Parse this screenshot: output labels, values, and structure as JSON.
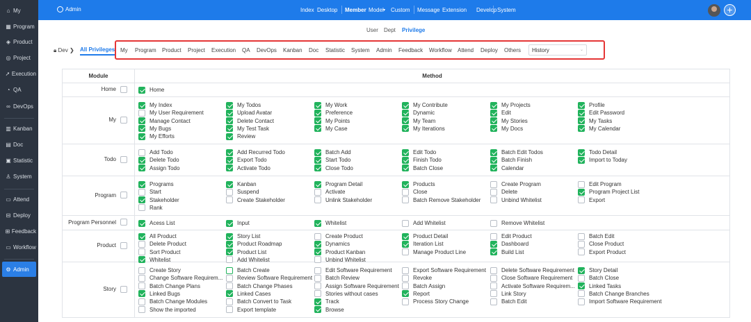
{
  "sidebar": {
    "items": [
      {
        "label": "My",
        "icon": "home-icon",
        "glyph": "⌂"
      },
      {
        "label": "Program",
        "icon": "grid-icon",
        "glyph": "▦"
      },
      {
        "label": "Product",
        "icon": "product-icon",
        "glyph": "◈"
      },
      {
        "label": "Project",
        "icon": "project-icon",
        "glyph": "◎"
      },
      {
        "label": "Execution",
        "icon": "execution-icon",
        "glyph": "➚"
      },
      {
        "label": "QA",
        "icon": "qa-icon",
        "glyph": "◔"
      },
      {
        "label": "DevOps",
        "icon": "devops-icon",
        "glyph": "∞"
      },
      {
        "label": "Kanban",
        "icon": "kanban-icon",
        "glyph": "▥"
      },
      {
        "label": "Doc",
        "icon": "doc-icon",
        "glyph": "▤"
      },
      {
        "label": "Statistic",
        "icon": "statistic-icon",
        "glyph": "▣"
      },
      {
        "label": "System",
        "icon": "system-icon",
        "glyph": "♙"
      },
      {
        "label": "Attend",
        "icon": "attend-icon",
        "glyph": "▭"
      },
      {
        "label": "Deploy",
        "icon": "deploy-icon",
        "glyph": "⊟"
      },
      {
        "label": "Feedback",
        "icon": "feedback-icon",
        "glyph": "⊞"
      },
      {
        "label": "Workflow",
        "icon": "workflow-icon",
        "glyph": "▭"
      },
      {
        "label": "Admin",
        "icon": "admin-icon",
        "glyph": "⚙"
      }
    ],
    "active": "Admin"
  },
  "topbar": {
    "brand": "Admin",
    "nav": [
      "Index",
      "Desktop",
      "Member",
      "Model",
      "Custom",
      "Message",
      "Extension",
      "Develop",
      "System"
    ],
    "active": "Member",
    "model_caret": "▾"
  },
  "subnav": {
    "items": [
      "User",
      "Dept",
      "Privilege"
    ],
    "active": "Privilege"
  },
  "breadcrumb": {
    "lock_icon": "lock-icon",
    "label": "Dev",
    "sep": "❯",
    "all": "All Privileges"
  },
  "module_tabs": [
    "My",
    "Program",
    "Product",
    "Project",
    "Execution",
    "QA",
    "DevOps",
    "Kanban",
    "Doc",
    "Statistic",
    "System",
    "Admin",
    "Feedback",
    "Workflow",
    "Attend",
    "Deploy",
    "Others"
  ],
  "history_select": {
    "value": "History",
    "caret": "⌄"
  },
  "table": {
    "header": {
      "module": "Module",
      "method": "Method"
    },
    "rows": [
      {
        "module": "Home",
        "checked": false,
        "items": [
          [
            "Home",
            true
          ]
        ]
      },
      {
        "module": "My",
        "checked": false,
        "items": [
          [
            "My Index",
            true
          ],
          [
            "My Todos",
            true
          ],
          [
            "My Work",
            true
          ],
          [
            "My Contribute",
            true
          ],
          [
            "My Projects",
            true
          ],
          [
            "Profile",
            true
          ],
          [
            "My User Requirement",
            false
          ],
          [
            "Upload Avatar",
            true
          ],
          [
            "Preference",
            true
          ],
          [
            "Dynamic",
            true
          ],
          [
            "Edit",
            true
          ],
          [
            "Edit Password",
            true
          ],
          [
            "Manage Contact",
            true
          ],
          [
            "Delete Contact",
            true
          ],
          [
            "My Points",
            true
          ],
          [
            "My Team",
            true
          ],
          [
            "My Stories",
            true
          ],
          [
            "My Tasks",
            true
          ],
          [
            "My Bugs",
            true
          ],
          [
            "My Test Task",
            true
          ],
          [
            "My Case",
            true
          ],
          [
            "My Iterations",
            true
          ],
          [
            "My Docs",
            true
          ],
          [
            "My Calendar",
            true
          ],
          [
            "My Efforts",
            true
          ],
          [
            "Review",
            true
          ]
        ]
      },
      {
        "module": "Todo",
        "checked": false,
        "items": [
          [
            "Add Todo",
            false
          ],
          [
            "Add Recurred Todo",
            true
          ],
          [
            "Batch Add",
            true
          ],
          [
            "Edit Todo",
            true
          ],
          [
            "Batch Edit Todos",
            true
          ],
          [
            "Todo Detail",
            true
          ],
          [
            "Delete Todo",
            true
          ],
          [
            "Export Todo",
            true
          ],
          [
            "Start Todo",
            true
          ],
          [
            "Finish Todo",
            true
          ],
          [
            "Batch Finish",
            true
          ],
          [
            "Import to Today",
            true
          ],
          [
            "Assign Todo",
            true
          ],
          [
            "Activate Todo",
            true
          ],
          [
            "Close Todo",
            true
          ],
          [
            "Batch Close",
            true
          ],
          [
            "Calendar",
            true
          ]
        ]
      },
      {
        "module": "Program",
        "checked": false,
        "items": [
          [
            "Programs",
            true
          ],
          [
            "Kanban",
            true
          ],
          [
            "Program Detail",
            true
          ],
          [
            "Products",
            true
          ],
          [
            "Create Program",
            false
          ],
          [
            "Edit Program",
            false
          ],
          [
            "Start",
            false
          ],
          [
            "Suspend",
            false
          ],
          [
            "Activate",
            false
          ],
          [
            "Close",
            false
          ],
          [
            "Delete",
            false
          ],
          [
            "Program Project List",
            true
          ],
          [
            "Stakeholder",
            true
          ],
          [
            "Create Stakeholder",
            false
          ],
          [
            "Unlink Stakeholder",
            false
          ],
          [
            "Batch Remove Stakeholder",
            false
          ],
          [
            "Unbind Whitelist",
            false
          ],
          [
            "Export",
            false
          ],
          [
            "Rank",
            false
          ]
        ]
      },
      {
        "module": "Program Personnel",
        "checked": false,
        "items": [
          [
            "Acess List",
            true
          ],
          [
            "Input",
            true
          ],
          [
            "Whitelist",
            true
          ],
          [
            "Add Whitelist",
            false
          ],
          [
            "Remove Whitelist",
            false
          ]
        ]
      },
      {
        "module": "Product",
        "checked": false,
        "items": [
          [
            "All Product",
            true
          ],
          [
            "Story List",
            true
          ],
          [
            "Create Product",
            false
          ],
          [
            "Product Detail",
            true
          ],
          [
            "Edit Product",
            false
          ],
          [
            "Batch Edit",
            false
          ],
          [
            "Delete Product",
            false
          ],
          [
            "Product Roadmap",
            true
          ],
          [
            "Dynamics",
            true
          ],
          [
            "Iteration List",
            true
          ],
          [
            "Dashboard",
            true
          ],
          [
            "Close Product",
            false
          ],
          [
            "Sort Product",
            false
          ],
          [
            "Product List",
            true
          ],
          [
            "Product Kanban",
            true
          ],
          [
            "Manage Product Line",
            false
          ],
          [
            "Build List",
            true
          ],
          [
            "Export Product",
            false
          ],
          [
            "Whitelist",
            true
          ],
          [
            "Add Whitelist",
            false
          ],
          [
            "Unbind Whitelist",
            false
          ]
        ]
      },
      {
        "module": "Story",
        "checked": false,
        "items": [
          [
            "Create Story",
            false
          ],
          [
            "Batch Create",
            false,
            "hl"
          ],
          [
            "Edit Software Requirement",
            false
          ],
          [
            "Export Software Requirement",
            false
          ],
          [
            "Delete Software Requirement",
            false
          ],
          [
            "Story Detail",
            true
          ],
          [
            "Change Software Requirem...",
            false
          ],
          [
            "Review Software Requirement",
            false
          ],
          [
            "Batch Review",
            false
          ],
          [
            "Revoke",
            false
          ],
          [
            "Close Software Requirement",
            false
          ],
          [
            "Batch Close",
            false
          ],
          [
            "Batch Change Plans",
            false
          ],
          [
            "Batch Change Phases",
            false
          ],
          [
            "Assign Software Requirement",
            false
          ],
          [
            "Batch Assign",
            false
          ],
          [
            "Activate Software Requirem...",
            false
          ],
          [
            "Linked Tasks",
            true
          ],
          [
            "Linked Bugs",
            true
          ],
          [
            "Linked Cases",
            true
          ],
          [
            "Stories without cases",
            false
          ],
          [
            "Report",
            true
          ],
          [
            "Link Story",
            false
          ],
          [
            "Batch Change Branches",
            false
          ],
          [
            "Batch Change Modules",
            false
          ],
          [
            "Batch Convert to Task",
            false
          ],
          [
            "Track",
            true
          ],
          [
            "Process Story Change",
            false
          ],
          [
            "Batch Edit",
            false
          ],
          [
            "Import Software Requirement",
            false
          ],
          [
            "Show the imported",
            false
          ],
          [
            "Export template",
            false
          ],
          [
            "Browse",
            true
          ]
        ]
      }
    ]
  }
}
